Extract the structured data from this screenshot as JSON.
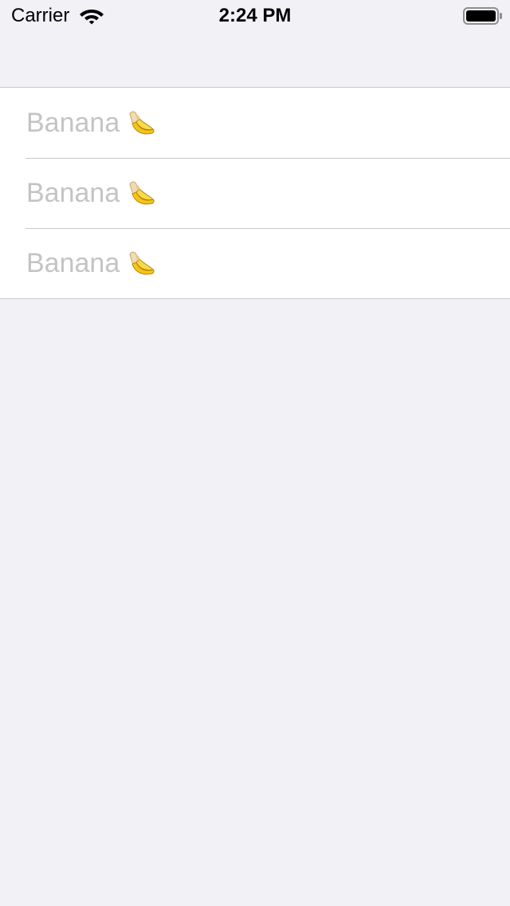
{
  "status_bar": {
    "carrier": "Carrier",
    "time": "2:24 PM"
  },
  "table": {
    "rows": [
      {
        "label": "Banana",
        "icon": "banana-icon"
      },
      {
        "label": "Banana",
        "icon": "banana-icon"
      },
      {
        "label": "Banana",
        "icon": "banana-icon"
      }
    ]
  },
  "colors": {
    "background": "#f1f1f6",
    "cell_background": "#ffffff",
    "separator": "#c8c7cc",
    "label_text": "#c4c4c6"
  }
}
